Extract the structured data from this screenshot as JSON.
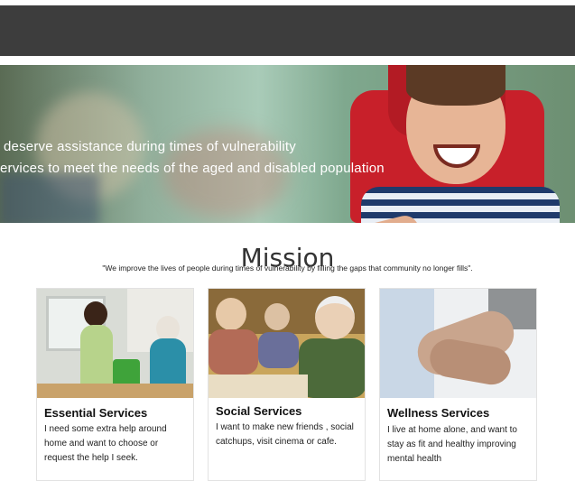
{
  "hero": {
    "line1": "deserve assistance during times of vulnerability",
    "line2": "ervices to meet the needs of the aged and disabled population"
  },
  "mission": {
    "title": "Mission",
    "quote": "\"We improve the lives of people during times of vulnerability by filling the gaps that community no longer fills\"."
  },
  "services": [
    {
      "title": "Essential Services",
      "text": "I need some extra help around home and want to choose or request the help I seek."
    },
    {
      "title": "Social Services",
      "text": "I want to make new friends , social catchups, visit cinema or cafe."
    },
    {
      "title": "Wellness Services",
      "text": "I live at home alone, and want to stay as fit and healthy improving mental health"
    }
  ]
}
